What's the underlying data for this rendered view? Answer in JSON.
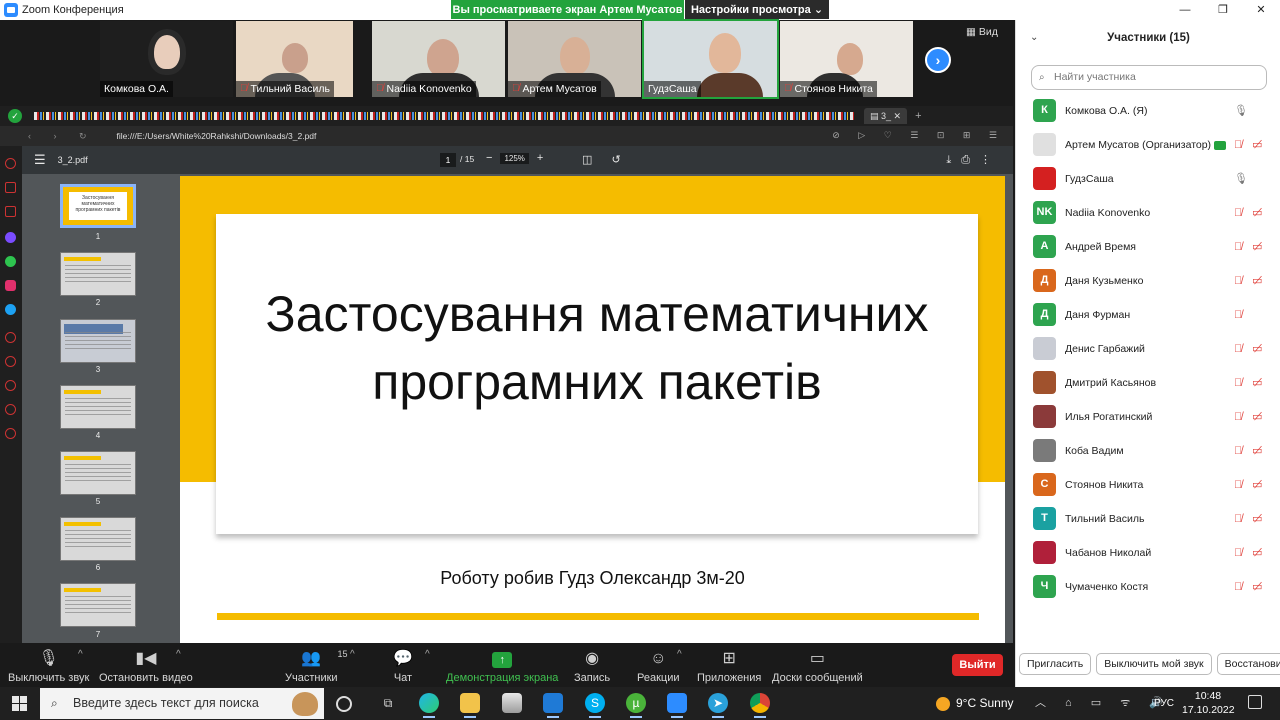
{
  "window": {
    "title": "Zoom Конференция"
  },
  "banner": {
    "share_text": "Вы просматриваете экран Артем Мусатов",
    "view_settings": "Настройки просмотра ⌄"
  },
  "video_strip": {
    "tiles": [
      {
        "name": "Комкова О.А.",
        "muted": false
      },
      {
        "name": "Тильний Василь",
        "muted": true
      },
      {
        "name": "Nadiia Konovenko",
        "muted": true
      },
      {
        "name": "Артем Мусатов",
        "muted": true
      },
      {
        "name": "ГудзСаша",
        "muted": false
      },
      {
        "name": "Стоянов Никита",
        "muted": true
      }
    ],
    "view_label": "Вид"
  },
  "browser": {
    "active_tab": "3_",
    "url": "file:///E:/Users/White%20Rahkshi/Downloads/3_2.pdf"
  },
  "pdf": {
    "filename": "3_2.pdf",
    "page": "1",
    "total": "/ 15",
    "zoom": "125%",
    "thumbs": [
      "1",
      "2",
      "3",
      "4",
      "5",
      "6",
      "7"
    ],
    "thumb1_text": "Застосування математичних програмних пакетів",
    "slide": {
      "title": "Застосування математичних програмних пакетів",
      "author": "Роботу робив Гудз Олександр 3м-20"
    }
  },
  "toolbar": {
    "mute": "Выключить звук",
    "video": "Остановить видео",
    "participants": "Участники",
    "participants_count": "15",
    "chat": "Чат",
    "share": "Демонстрация экрана",
    "record": "Запись",
    "reactions": "Реакции",
    "apps": "Приложения",
    "whiteboard": "Доски сообщений",
    "leave": "Выйти"
  },
  "participants_panel": {
    "title": "Участники (15)",
    "search_placeholder": "Найти участника",
    "list": [
      {
        "name": "Комкова О.А. (Я)",
        "avatar": "К",
        "color": "#2ea44f",
        "mic": "on",
        "cam": "none"
      },
      {
        "name": "Артем Мусатов (Организатор)",
        "avatar": "",
        "color": "#e0e0e0",
        "mic": "off",
        "cam": "off",
        "host": true
      },
      {
        "name": "ГудзСаша",
        "avatar": "",
        "color": "#d42020",
        "mic": "on",
        "cam": "none"
      },
      {
        "name": "Nadiia Konovenko",
        "avatar": "NK",
        "color": "#2ea44f",
        "mic": "off",
        "cam": "off"
      },
      {
        "name": "Андрей Время",
        "avatar": "А",
        "color": "#2ea44f",
        "mic": "off",
        "cam": "off"
      },
      {
        "name": "Даня Кузьменко",
        "avatar": "Д",
        "color": "#d9671c",
        "mic": "off",
        "cam": "off"
      },
      {
        "name": "Даня Фурман",
        "avatar": "Д",
        "color": "#2ea44f",
        "mic": "off",
        "cam": "none"
      },
      {
        "name": "Денис Гарбажий",
        "avatar": "",
        "color": "#c9ccd4",
        "mic": "off",
        "cam": "off"
      },
      {
        "name": "Дмитрий Касьянов",
        "avatar": "",
        "color": "#a0522d",
        "mic": "off",
        "cam": "off"
      },
      {
        "name": "Илья Рогатинский",
        "avatar": "",
        "color": "#8b3a3a",
        "mic": "off",
        "cam": "off"
      },
      {
        "name": "Коба Вадим",
        "avatar": "",
        "color": "#7a7a7a",
        "mic": "off",
        "cam": "off"
      },
      {
        "name": "Стоянов Никита",
        "avatar": "С",
        "color": "#d9671c",
        "mic": "off",
        "cam": "off"
      },
      {
        "name": "Тильний Василь",
        "avatar": "Т",
        "color": "#1aa1a1",
        "mic": "off",
        "cam": "off"
      },
      {
        "name": "Чабанов Николай",
        "avatar": "",
        "color": "#b0203a",
        "mic": "off",
        "cam": "off"
      },
      {
        "name": "Чумаченко Костя",
        "avatar": "Ч",
        "color": "#2ea44f",
        "mic": "off",
        "cam": "off"
      }
    ],
    "buttons": [
      "Пригласить",
      "Выключить мой звук",
      "Восстановить"
    ]
  },
  "taskbar": {
    "search_placeholder": "Введите здесь текст для поиска",
    "weather": "9°C  Sunny",
    "lang": "РУС",
    "time": "10:48",
    "date": "17.10.2022"
  }
}
